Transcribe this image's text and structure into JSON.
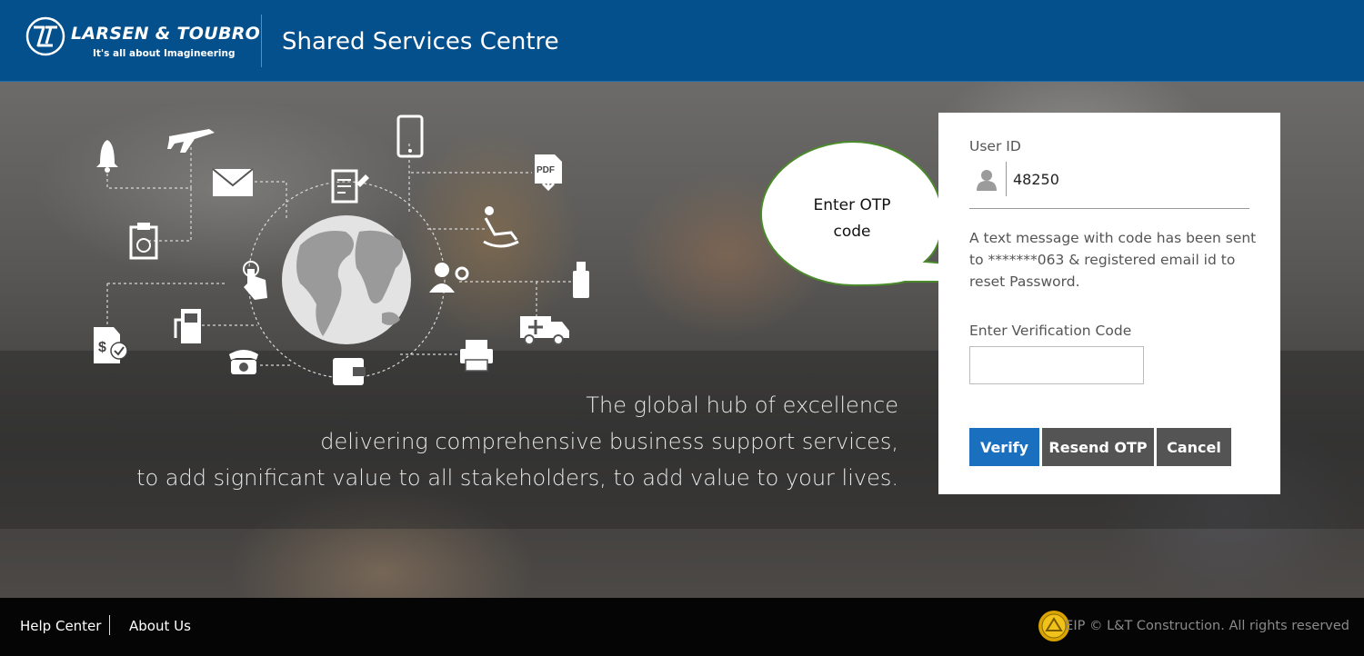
{
  "header": {
    "brand_name": "LARSEN & TOUBRO",
    "brand_tagline": "It's all about Imagineering",
    "site_title": "Shared Services Centre"
  },
  "hero": {
    "tagline_line1": "The global hub of excellence",
    "tagline_line2": "delivering comprehensive business support services,",
    "tagline_line3": "to add significant value to all stakeholders, to add value to your lives.",
    "icons": [
      "bell-icon",
      "airplane-icon",
      "envelope-icon",
      "clipboard-check-icon",
      "tap-icon",
      "bill-icon",
      "fuel-pump-icon",
      "telephone-icon",
      "document-edit-icon",
      "globe-icon",
      "wallet-icon",
      "mobile-phone-icon",
      "pdf-download-icon",
      "recliner-icon",
      "user-settings-icon",
      "usb-drive-icon",
      "ambulance-icon",
      "printer-icon"
    ]
  },
  "callout": {
    "line1": "Enter OTP",
    "line2": "code"
  },
  "login": {
    "user_id_label": "User ID",
    "user_id_value": "48250",
    "message": "A text message with code has been sent to *******063 & registered email id to reset Password.",
    "verification_label": "Enter Verification Code",
    "verification_value": "",
    "verify_label": "Verify",
    "resend_label": "Resend OTP",
    "cancel_label": "Cancel"
  },
  "footer": {
    "help_label": "Help Center",
    "about_label": "About Us",
    "copyright": "EIP © L&T Construction. All rights reserved"
  },
  "colors": {
    "header_bg": "#04508d",
    "verify_button": "#1a6fbf",
    "secondary_button": "#545454",
    "footer_bg": "#050505",
    "callout_border": "#4a8a2a"
  }
}
